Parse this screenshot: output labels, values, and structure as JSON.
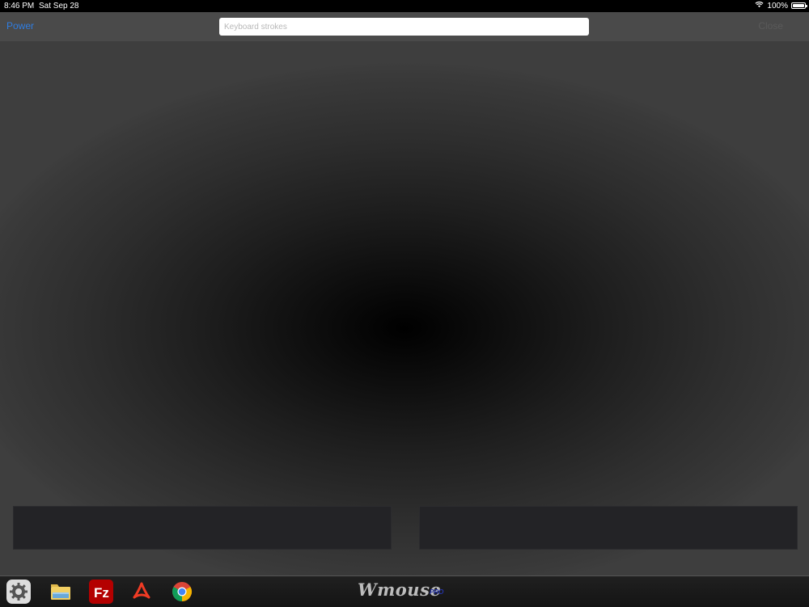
{
  "status_bar": {
    "time": "8:46 PM",
    "date": "Sat Sep 28",
    "battery_percent": "100%",
    "battery_level": 1.0,
    "wifi_icon": "wifi-icon",
    "battery_icon": "battery-icon"
  },
  "nav_bar": {
    "power_label": "Power",
    "keyboard_placeholder": "Keyboard strokes",
    "keyboard_value": "",
    "close_label": "Close"
  },
  "dock": {
    "icons": [
      "settings-gear-icon",
      "file-explorer-icon",
      "filezilla-icon",
      "acrobat-icon",
      "chrome-icon"
    ],
    "brand": "Wmouse",
    "brand_sub": "PRO"
  },
  "colors": {
    "accent": "#2f7de1",
    "disabled": "#5a5a5a",
    "touchpad_center": "#000000",
    "mouse_button": "#232326"
  }
}
